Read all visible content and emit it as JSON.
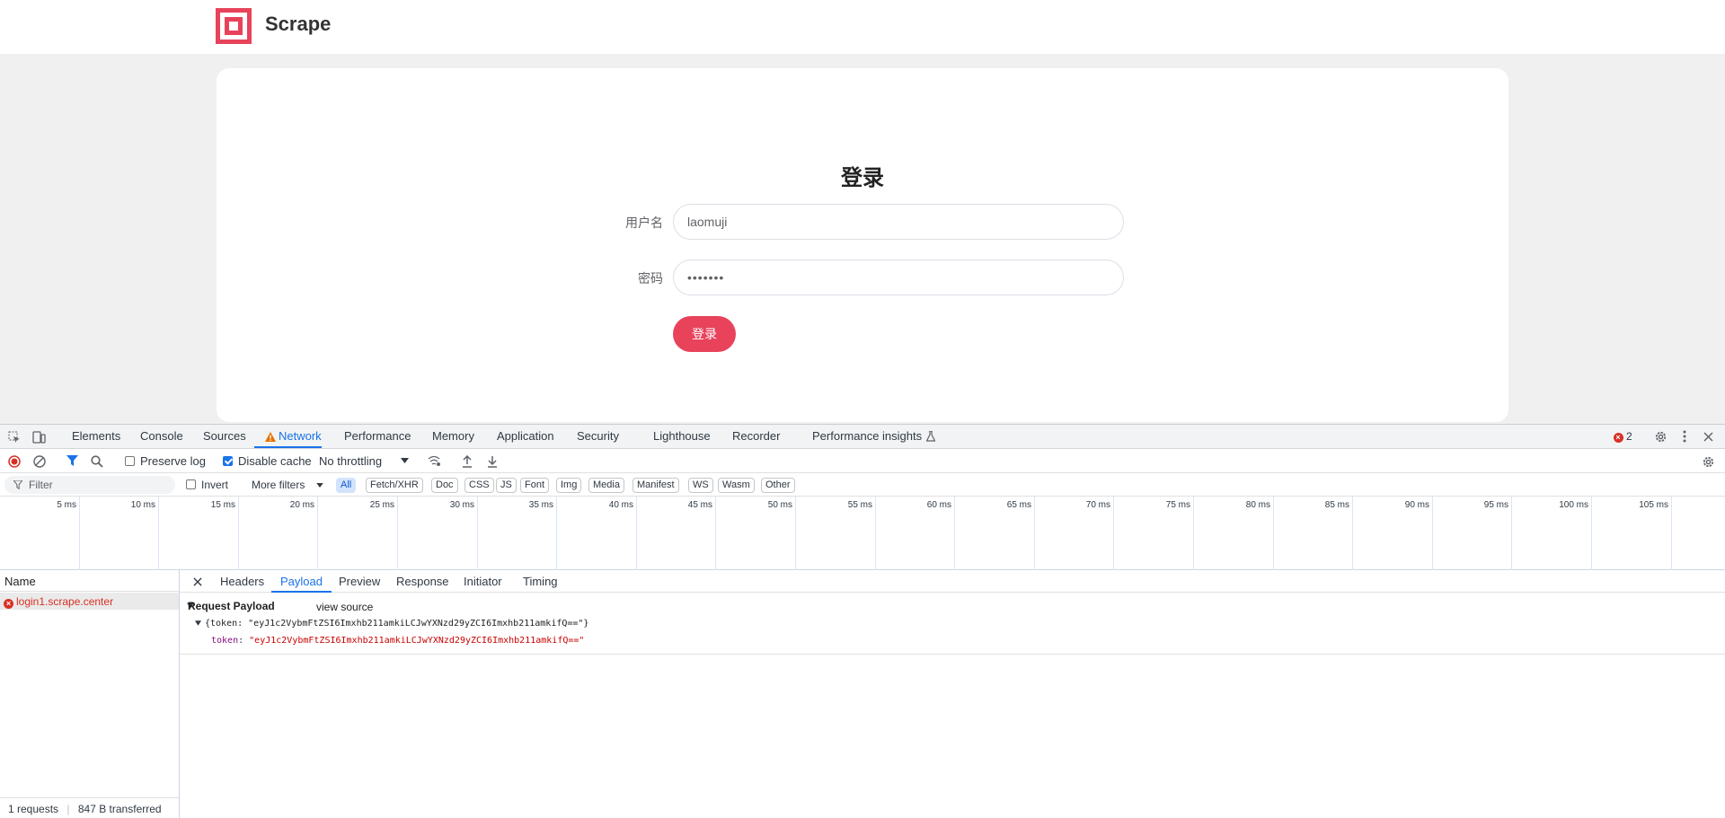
{
  "site": {
    "brand": "Scrape",
    "login_title": "登录",
    "username_label": "用户名",
    "username_value": "laomuji",
    "password_label": "密码",
    "password_value": "•••••••",
    "login_button": "登录"
  },
  "devtools": {
    "tabs": [
      "Elements",
      "Console",
      "Sources",
      "Network",
      "Performance",
      "Memory",
      "Application",
      "Security",
      "Lighthouse",
      "Recorder",
      "Performance insights"
    ],
    "active_tab": "Network",
    "error_count": "2",
    "toolbar": {
      "preserve_log": "Preserve log",
      "preserve_log_checked": false,
      "disable_cache": "Disable cache",
      "disable_cache_checked": true,
      "throttling": "No throttling"
    },
    "filter": {
      "placeholder": "Filter",
      "invert": "Invert",
      "more_filters": "More filters",
      "types": [
        "All",
        "Fetch/XHR",
        "Doc",
        "CSS",
        "JS",
        "Font",
        "Img",
        "Media",
        "Manifest",
        "WS",
        "Wasm",
        "Other"
      ],
      "active_type": "All"
    },
    "timeline_ticks": [
      "5 ms",
      "10 ms",
      "15 ms",
      "20 ms",
      "25 ms",
      "30 ms",
      "35 ms",
      "40 ms",
      "45 ms",
      "50 ms",
      "55 ms",
      "60 ms",
      "65 ms",
      "70 ms",
      "75 ms",
      "80 ms",
      "85 ms",
      "90 ms",
      "95 ms",
      "100 ms",
      "105 ms"
    ],
    "requests": {
      "header": "Name",
      "items": [
        "login1.scrape.center"
      ]
    },
    "status": {
      "requests": "1 requests",
      "transferred": "847 B transferred"
    },
    "detail": {
      "tabs": [
        "Headers",
        "Payload",
        "Preview",
        "Response",
        "Initiator",
        "Timing"
      ],
      "active_tab": "Payload",
      "section_title": "Request Payload",
      "view_source": "view source",
      "summary_line": "{token: \"eyJ1c2VybmFtZSI6Imxhb211amkiLCJwYXNzd29yZCI6Imxhb211amkifQ==\"}",
      "token_key": "token",
      "token_value": "\"eyJ1c2VybmFtZSI6Imxhb211amkiLCJwYXNzd29yZCI6Imxhb211amkifQ==\""
    }
  }
}
